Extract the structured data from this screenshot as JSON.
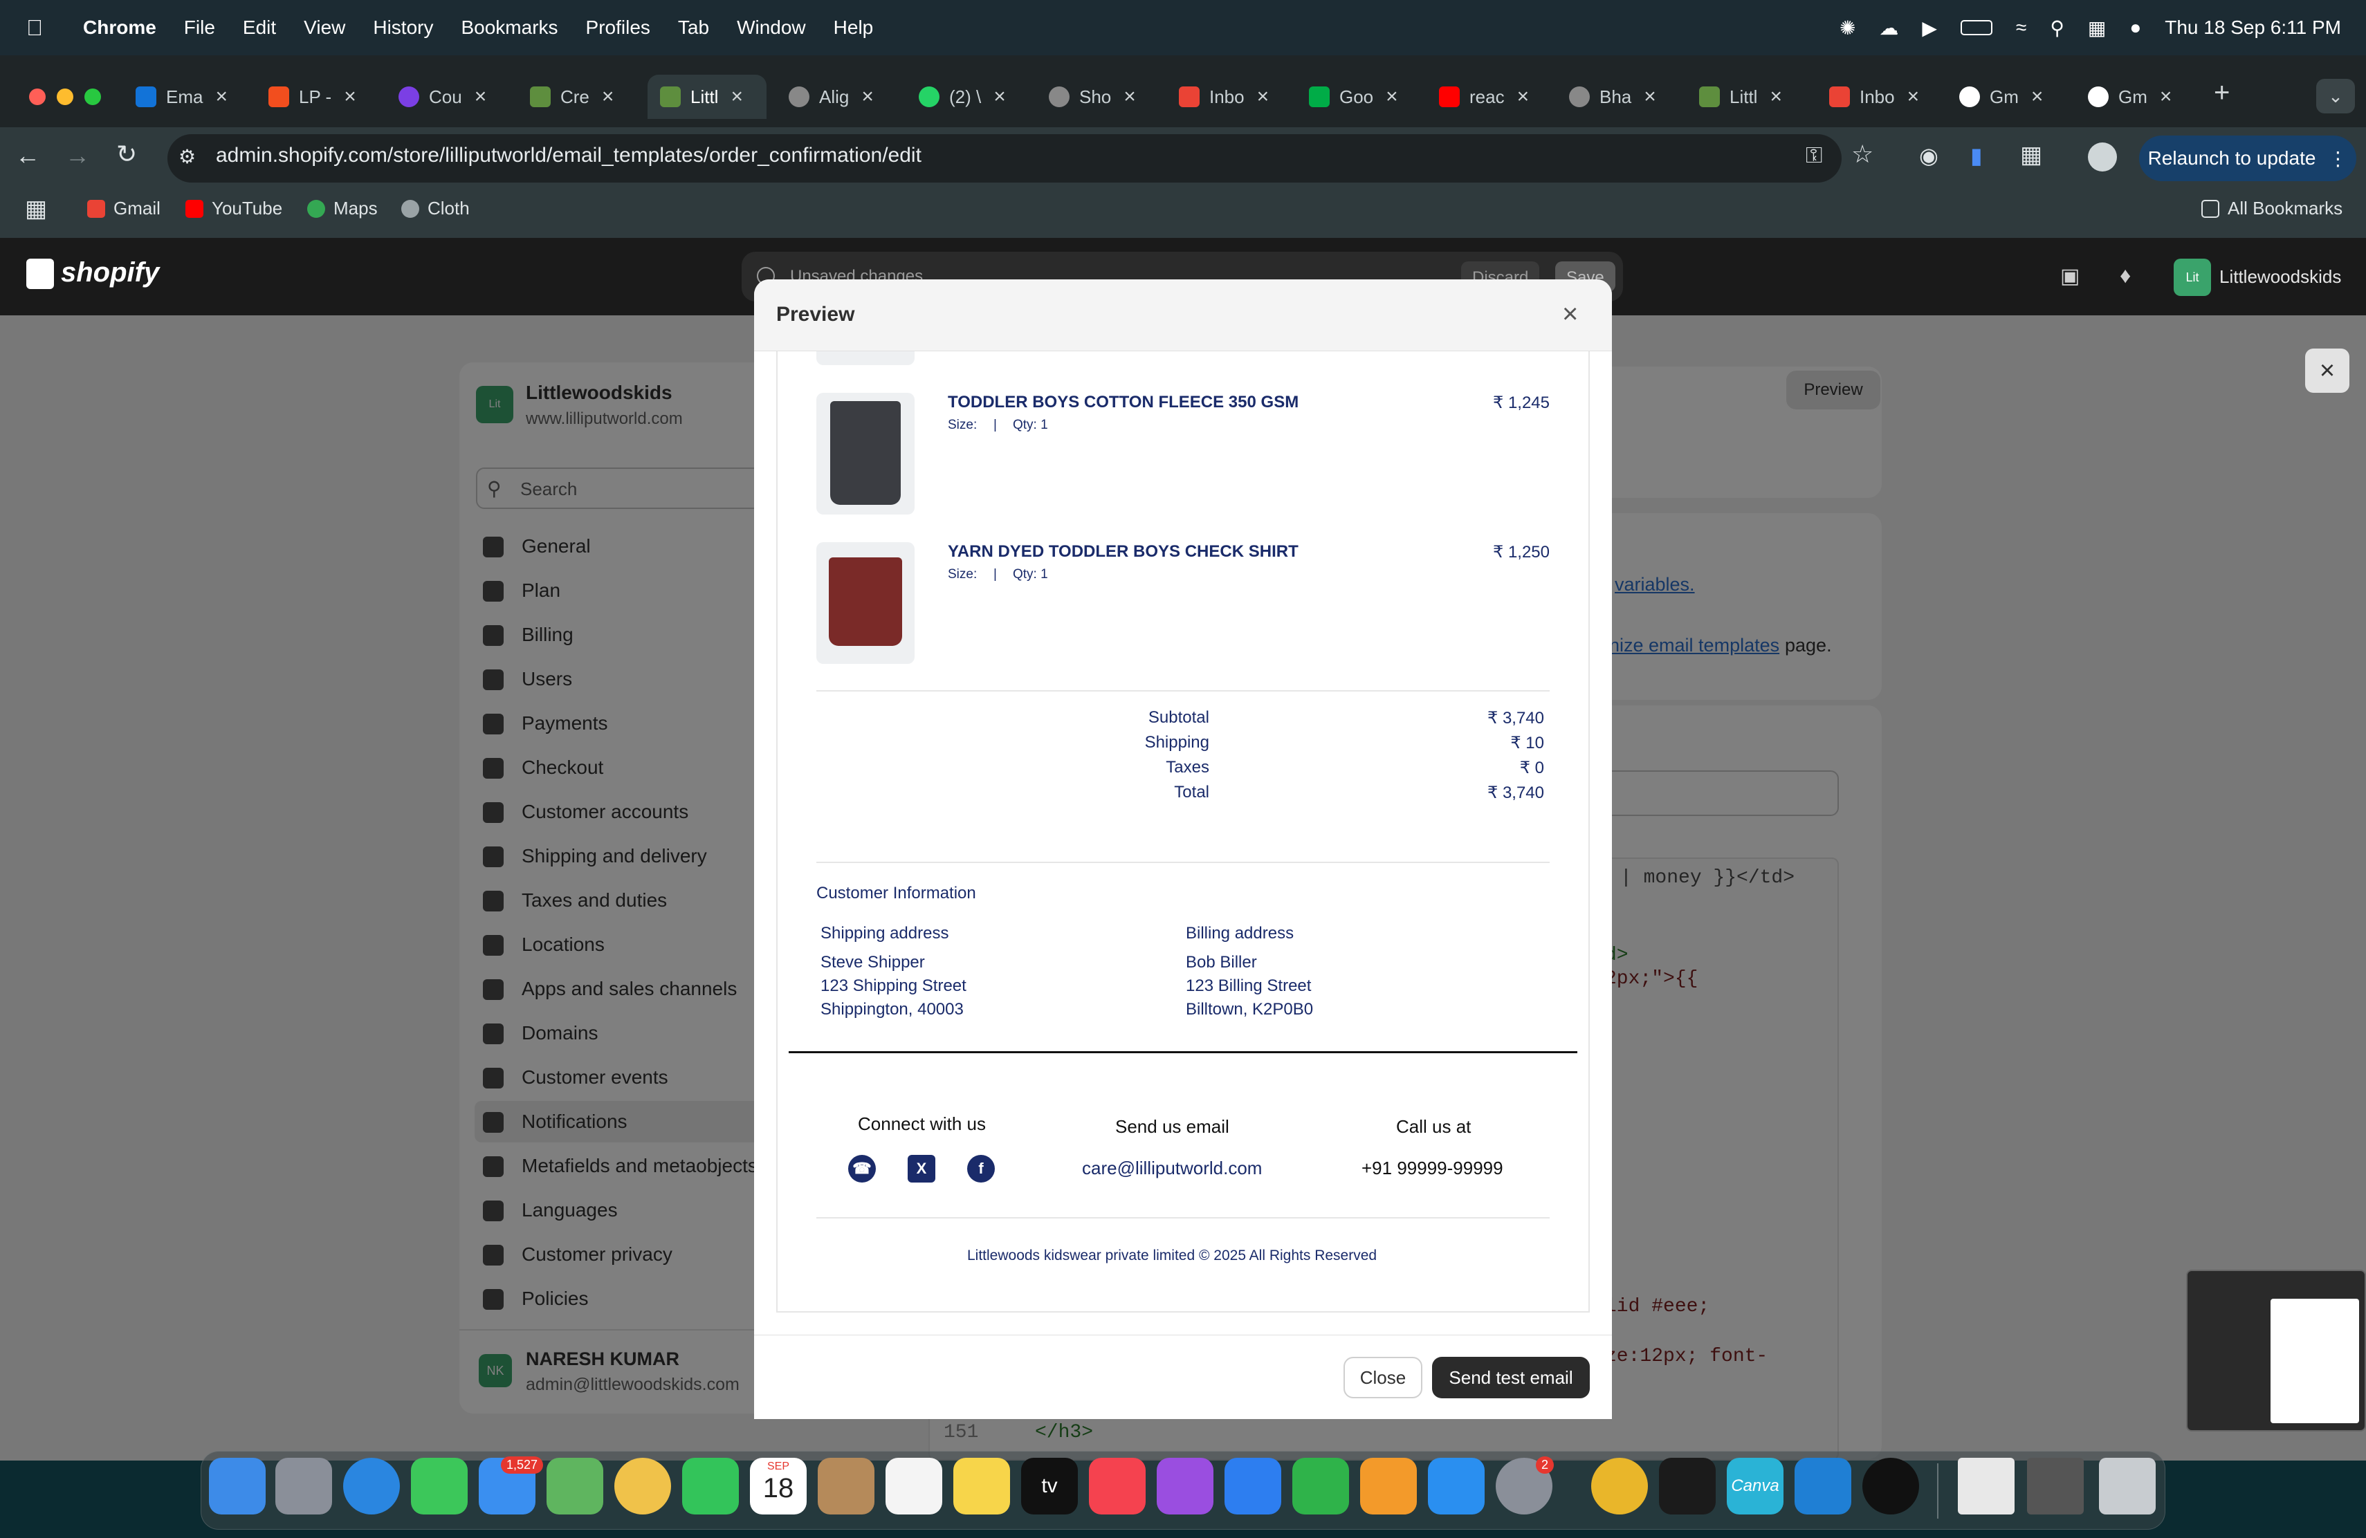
{
  "menubar": {
    "app": "Chrome",
    "items": [
      "File",
      "Edit",
      "View",
      "History",
      "Bookmarks",
      "Profiles",
      "Tab",
      "Window",
      "Help"
    ],
    "datetime": "Thu 18 Sep  6:11 PM"
  },
  "browser": {
    "tabs": [
      "Ema",
      "LP -",
      "Cou",
      "Cre",
      "Littl",
      "Alig",
      "(2) \\",
      "Sho",
      "Inbo",
      "Goo",
      "reac",
      "Bha",
      "Littl",
      "Inbo",
      "Gm",
      "Gm"
    ],
    "url": "admin.shopify.com/store/lilliputworld/email_templates/order_confirmation/edit",
    "relaunch": "Relaunch to update",
    "bookmarks": [
      "Gmail",
      "YouTube",
      "Maps",
      "Cloth"
    ],
    "all_bookmarks": "All Bookmarks"
  },
  "shopify": {
    "logo": "shopify",
    "unsaved": "Unsaved changes",
    "discard": "Discard",
    "save": "Save",
    "store_initials": "Lit",
    "store_name": "Littlewoodskids",
    "store_url": "www.lilliputworld.com",
    "search_placeholder": "Search",
    "sidebar": [
      "General",
      "Plan",
      "Billing",
      "Users",
      "Payments",
      "Checkout",
      "Customer accounts",
      "Shipping and delivery",
      "Taxes and duties",
      "Locations",
      "Apps and sales channels",
      "Domains",
      "Customer events",
      "Notifications",
      "Metafields and metaobjects",
      "Languages",
      "Customer privacy",
      "Policies"
    ],
    "user_initials": "NK",
    "user_name": "NARESH KUMAR",
    "user_email": "admin@littlewoodskids.com",
    "preview_btn": "Preview",
    "link_variables": "variables.",
    "link_templates": "nize email templates",
    "page_text": "page.",
    "code_lines": [
      "| money }}</td>",
      "d>",
      "2px;\">{{",
      "lid #eee;",
      "ze:12px; font-",
      "</h3>"
    ],
    "line_number": "151"
  },
  "modal": {
    "title": "Preview",
    "close": "Close",
    "send": "Send test email",
    "products": [
      {
        "name": "TODDLER BOYS COTTON FLEECE 350 GSM",
        "size": "Size:",
        "qty": "Qty: 1",
        "price": "₹ 1,245"
      },
      {
        "name": "YARN DYED TODDLER BOYS CHECK SHIRT",
        "size": "Size:",
        "qty": "Qty: 1",
        "price": "₹ 1,250"
      }
    ],
    "summary": [
      {
        "label": "Subtotal",
        "value": "₹ 3,740"
      },
      {
        "label": "Shipping",
        "value": "₹ 10"
      },
      {
        "label": "Taxes",
        "value": "₹ 0"
      },
      {
        "label": "Total",
        "value": "₹ 3,740"
      }
    ],
    "customer_info": "Customer Information",
    "shipping_title": "Shipping address",
    "shipping_lines": [
      "Steve Shipper",
      "123 Shipping Street",
      "Shippington, 40003"
    ],
    "billing_title": "Billing address",
    "billing_lines": [
      "Bob Biller",
      "123 Billing Street",
      "Billtown, K2P0B0"
    ],
    "connect": "Connect with us",
    "email_us": "Send us email",
    "email": "care@lilliputworld.com",
    "call_us": "Call us at",
    "phone": "+91 99999-99999",
    "copyright": "Littlewoods kidswear private limited © 2025 All Rights Reserved"
  },
  "dock": {
    "mail_badge": "1,527",
    "calendar_month": "SEP",
    "calendar_day": "18",
    "settings_badge": "2",
    "tv_label": "tv",
    "canva_label": "Canva"
  }
}
